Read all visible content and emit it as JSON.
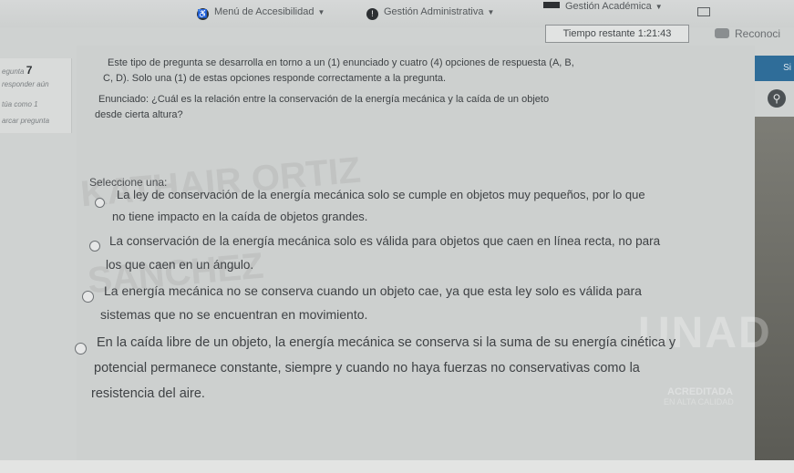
{
  "nav": {
    "accessibility": "Menú de Accesibilidad",
    "admin": "Gestión Administrativa",
    "academic": "Gestión Académica"
  },
  "timer": "Tiempo restante 1:21:43",
  "recognition": "Reconoci",
  "question_info": {
    "label": "egunta",
    "number": "7",
    "status": "responder aún",
    "score": "túa como 1",
    "flag": "arcar pregunta"
  },
  "side_button": "Si",
  "instructions": {
    "line1": "Este tipo de pregunta se desarrolla en torno a un (1) enunciado y cuatro (4) opciones de respuesta (A, B,",
    "line2": "C, D). Solo una (1) de estas opciones responde correctamente a la pregunta.",
    "line3": "Enunciado: ¿Cuál es la relación entre la conservación de la energía mecánica y la caída de un objeto",
    "line4": "desde cierta altura?"
  },
  "prompt": "Seleccione una:",
  "options": [
    {
      "line1": "La ley de conservación de la energía mecánica solo se cumple en objetos muy pequeños, por lo que",
      "line2": "no tiene impacto en la caída de objetos grandes."
    },
    {
      "line1": "La conservación de la energía mecánica solo es válida para objetos que caen en línea recta, no para",
      "line2": "los que caen en un ángulo."
    },
    {
      "line1": "La energía mecánica no se conserva cuando un objeto cae, ya que esta ley solo es válida para",
      "line2": "sistemas que no se encuentran en movimiento."
    },
    {
      "line1": "En la caída libre de un objeto, la energía mecánica se conserva si la suma de su energía cinética y",
      "line2": "potencial permanece constante, siempre y cuando no haya fuerzas no conservativas como la",
      "line3": "resistencia del aire."
    }
  ],
  "watermark": {
    "name1": "KATHAIR ORTIZ",
    "name2": "SANCHEZ",
    "logo": "UNAD",
    "accredited": "ACREDITADA",
    "quality": "EN ALTA CALIDAD"
  },
  "colors": {
    "accent": "#2f6d99",
    "background": "#cdd0cf"
  }
}
